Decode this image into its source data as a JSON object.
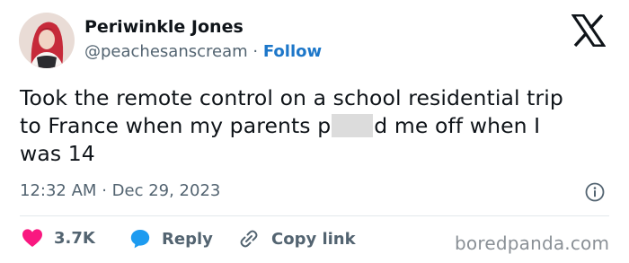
{
  "author": {
    "display_name": "Periwinkle Jones",
    "handle": "@peachesanscream",
    "separator": "·",
    "follow_label": "Follow",
    "avatar_icon": "profile-photo"
  },
  "header": {
    "logo_icon": "x-logo"
  },
  "tweet": {
    "line1": "Took the remote control on a school residential trip",
    "line2_before": "to France when my parents p",
    "line2_after": "d me off when I",
    "line3": "was 14"
  },
  "meta": {
    "time": "12:32 AM",
    "separator": "·",
    "date": "Dec 29, 2023",
    "info_icon": "info-icon"
  },
  "actions": {
    "likes": "3.7K",
    "reply_label": "Reply",
    "copy_link_label": "Copy link"
  },
  "watermark": "boredpanda.com",
  "colors": {
    "text": "#0f1419",
    "secondary": "#536471",
    "link": "#1d77c9",
    "heart": "#f91880",
    "reply": "#1d9bf0"
  }
}
